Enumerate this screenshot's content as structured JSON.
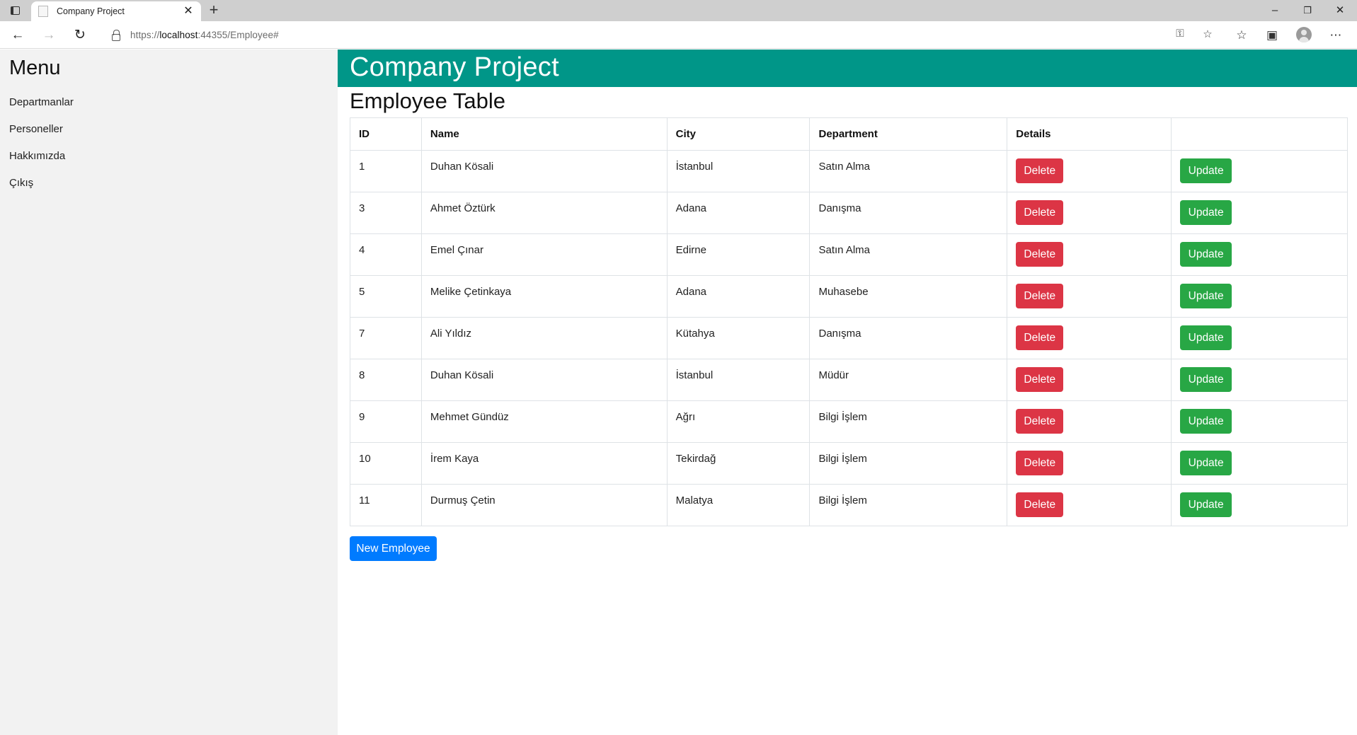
{
  "browser": {
    "tab_title": "Company Project",
    "url_scheme": "https://",
    "url_host": "localhost",
    "url_path": ":44355/Employee#",
    "more_label": "⋯"
  },
  "sidebar": {
    "title": "Menu",
    "items": [
      {
        "label": "Departmanlar"
      },
      {
        "label": "Personeller"
      },
      {
        "label": "Hakkımızda"
      },
      {
        "label": "Çıkış"
      }
    ]
  },
  "header": {
    "title": "Company Project"
  },
  "page": {
    "title": "Employee Table"
  },
  "table": {
    "columns": [
      "ID",
      "Name",
      "City",
      "Department",
      "Details",
      ""
    ],
    "delete_label": "Delete",
    "update_label": "Update",
    "rows": [
      {
        "id": "1",
        "name": "Duhan Kösali",
        "city": "İstanbul",
        "department": "Satın Alma"
      },
      {
        "id": "3",
        "name": "Ahmet Öztürk",
        "city": "Adana",
        "department": "Danışma"
      },
      {
        "id": "4",
        "name": "Emel Çınar",
        "city": "Edirne",
        "department": "Satın Alma"
      },
      {
        "id": "5",
        "name": "Melike Çetinkaya",
        "city": "Adana",
        "department": "Muhasebe"
      },
      {
        "id": "7",
        "name": "Ali Yıldız",
        "city": "Kütahya",
        "department": "Danışma"
      },
      {
        "id": "8",
        "name": "Duhan Kösali",
        "city": "İstanbul",
        "department": "Müdür"
      },
      {
        "id": "9",
        "name": "Mehmet Gündüz",
        "city": "Ağrı",
        "department": "Bilgi İşlem"
      },
      {
        "id": "10",
        "name": "İrem Kaya",
        "city": "Tekirdağ",
        "department": "Bilgi İşlem"
      },
      {
        "id": "11",
        "name": "Durmuş Çetin",
        "city": "Malatya",
        "department": "Bilgi İşlem"
      }
    ]
  },
  "actions": {
    "new_employee_label": "New Employee"
  },
  "colors": {
    "banner": "#009688",
    "danger": "#dc3545",
    "success": "#28a745",
    "primary": "#007bff",
    "sidebar_bg": "#f2f2f2"
  }
}
